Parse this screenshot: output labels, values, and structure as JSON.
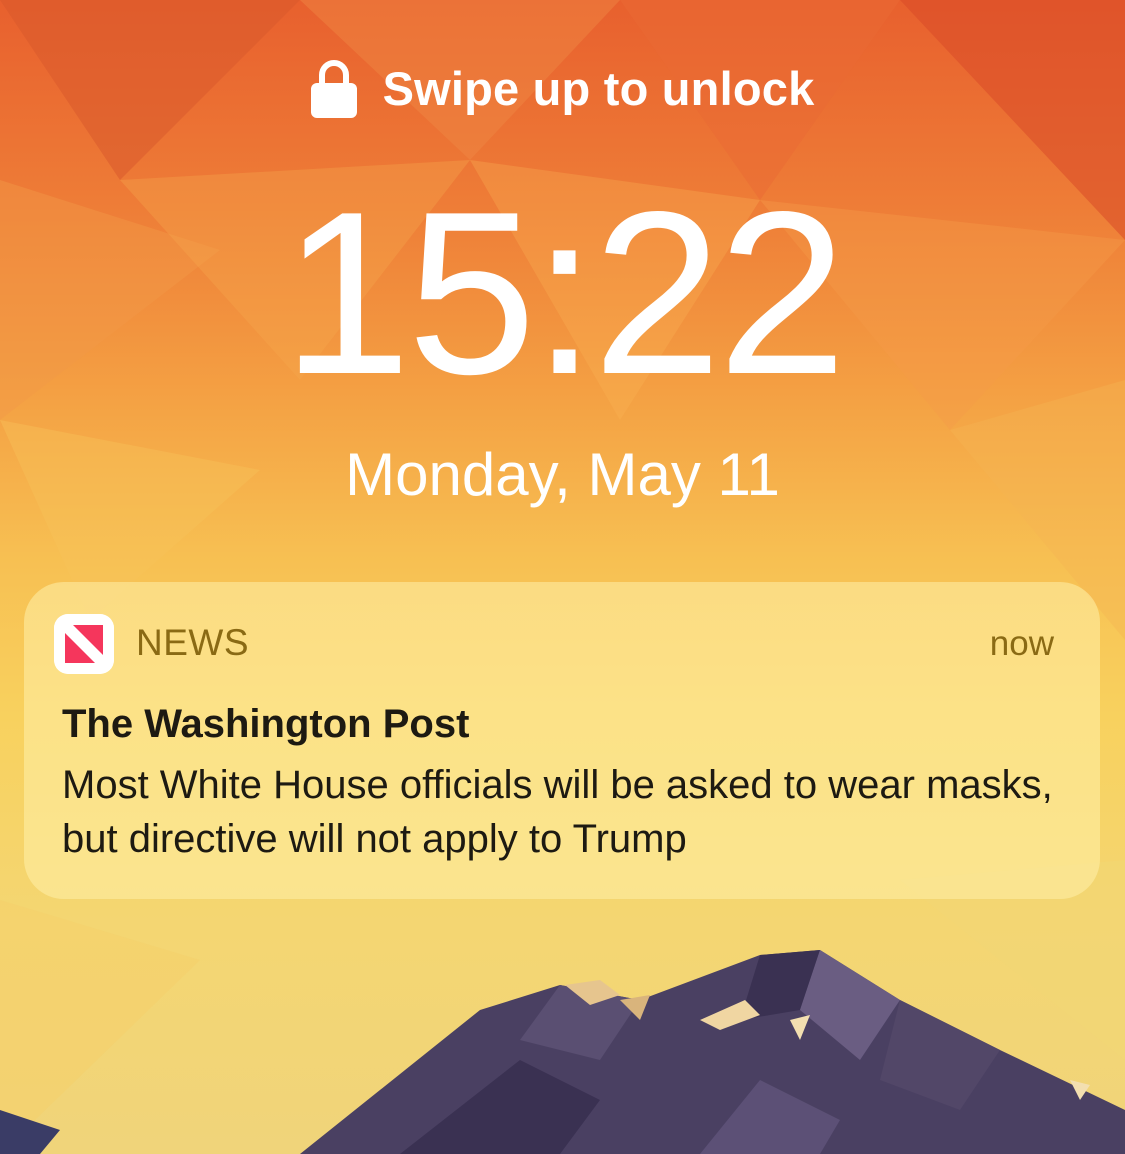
{
  "lockscreen": {
    "unlock_hint": "Swipe up to unlock",
    "time": "15:22",
    "date": "Monday, May 11"
  },
  "notification": {
    "app_name": "NEWS",
    "time": "now",
    "title": "The Washington Post",
    "body": "Most White House officials will be asked to wear masks, but directive will not apply to Trump",
    "app_icon": "apple-news-icon"
  },
  "colors": {
    "news_icon_red": "#f5365c",
    "notification_meta": "#8a6a14",
    "text_dark": "#1d1a12"
  }
}
